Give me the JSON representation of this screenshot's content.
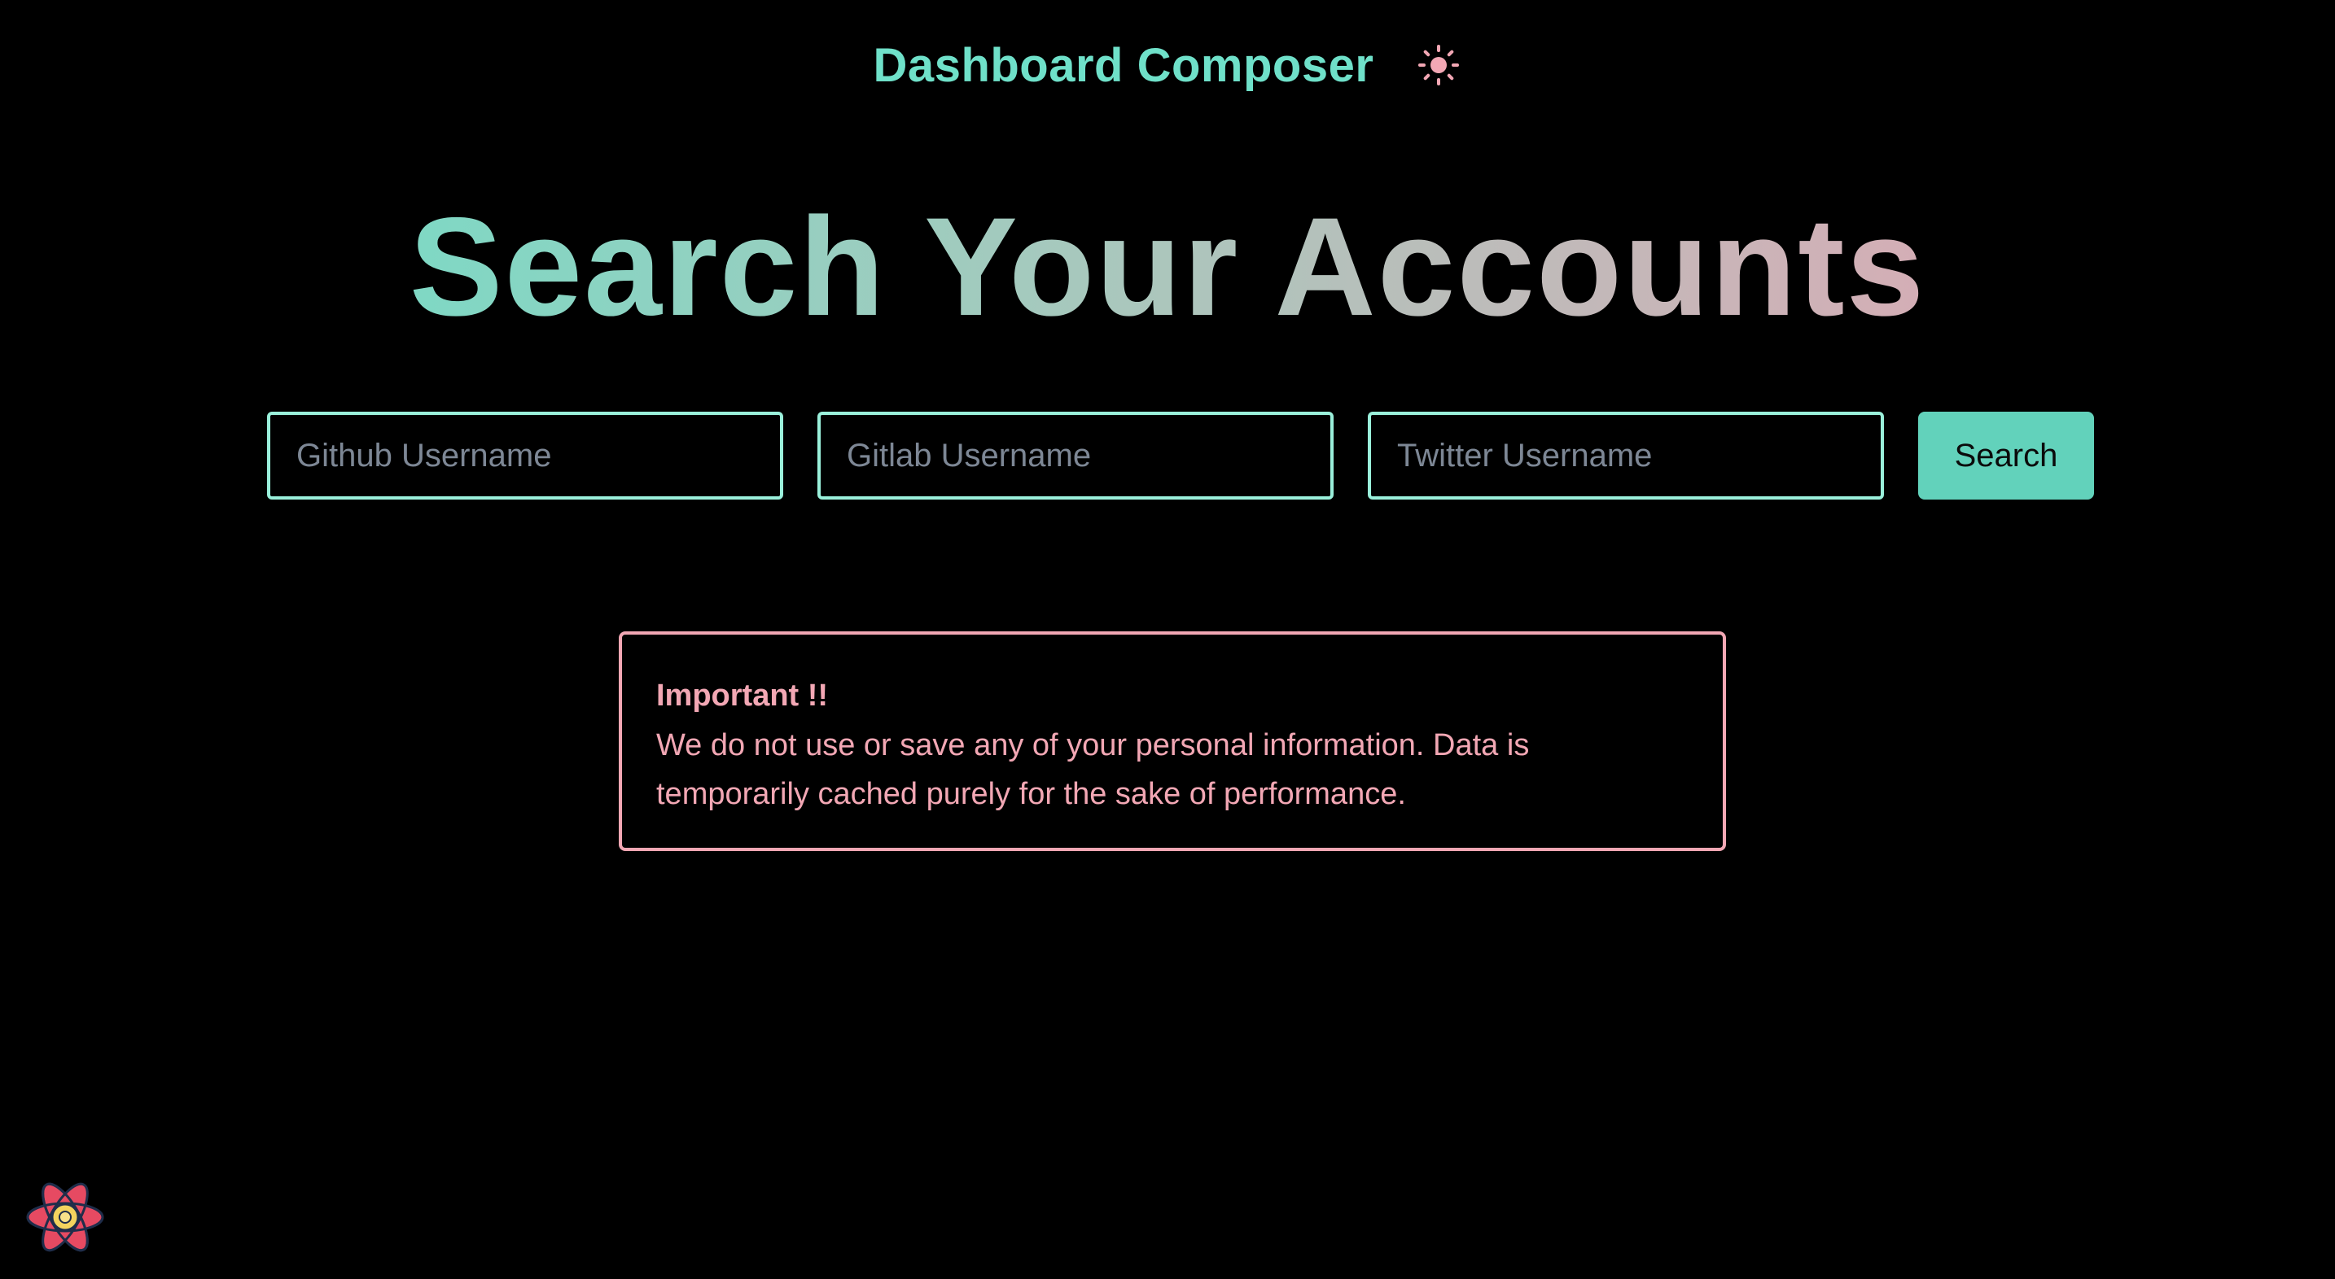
{
  "header": {
    "brand": "Dashboard Composer",
    "theme_icon": "sun-icon"
  },
  "hero": {
    "title": "Search Your Accounts"
  },
  "search": {
    "github_placeholder": "Github Username",
    "gitlab_placeholder": "Gitlab Username",
    "twitter_placeholder": "Twitter Username",
    "button_label": "Search"
  },
  "notice": {
    "title": "Important !!",
    "body": "We do not use or save any of your personal information. Data is temporarily cached purely for the sake of performance."
  },
  "footer": {
    "logo_icon": "atom-logo-icon"
  },
  "colors": {
    "accent": "#6fe0c9",
    "input_border": "#9af0db",
    "button_bg": "#62d2bb",
    "notice": "#f2a7b4",
    "background": "#000000",
    "theme_icon": "#f2a7b4"
  }
}
